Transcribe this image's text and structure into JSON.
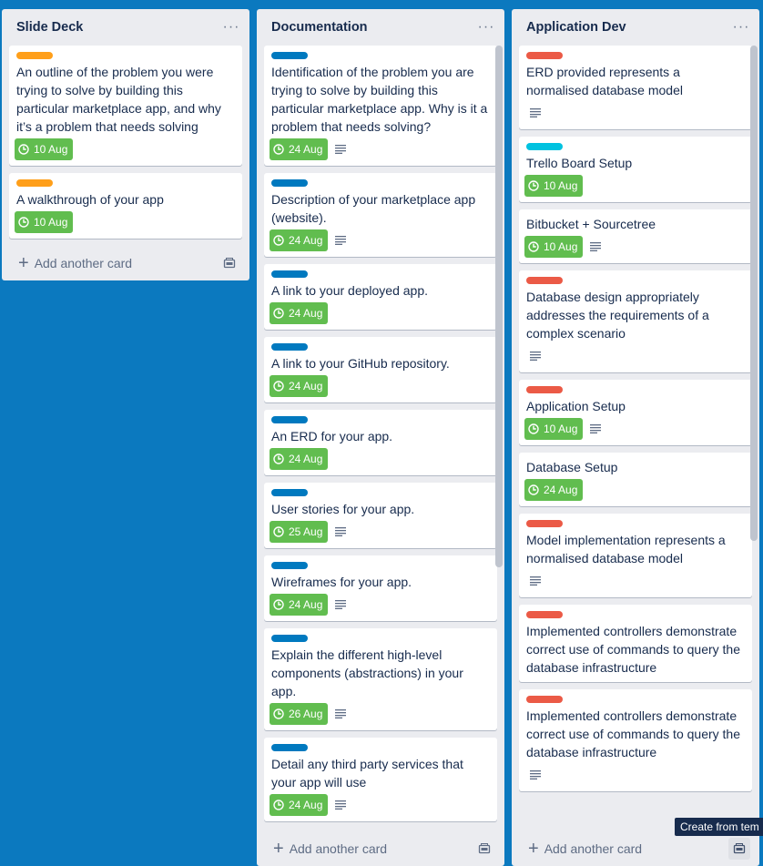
{
  "colors": {
    "board_bg": "#0b79bf",
    "label_orange": "#ff9f1a",
    "label_blue": "#0079bf",
    "label_red": "#eb5a46",
    "label_sky": "#00c2e0",
    "due_green": "#61bd4f"
  },
  "icons": {
    "menu": "ellipsis-icon",
    "due": "clock-icon",
    "description": "description-lines-icon",
    "add": "plus-icon",
    "template": "card-template-icon"
  },
  "add_card_label": "Add another card",
  "tooltip": "Create from tem",
  "lists": [
    {
      "title": "Slide Deck",
      "menu": "···",
      "cards": [
        {
          "label": "orange",
          "title": "An outline of the problem you were trying to solve by building this particular marketplace app, and why it’s a problem that needs solving",
          "due": "10 Aug",
          "desc": false
        },
        {
          "label": "orange",
          "title": "A walkthrough of your app",
          "due": "10 Aug",
          "desc": false
        }
      ]
    },
    {
      "title": "Documentation",
      "menu": "···",
      "cards": [
        {
          "label": "blue",
          "title": "Identification of the problem you are trying to solve by building this particular marketplace app. Why is it a problem that needs solving?",
          "due": "24 Aug",
          "desc": true
        },
        {
          "label": "blue",
          "title": "Description of your marketplace app (website).",
          "due": "24 Aug",
          "desc": true
        },
        {
          "label": "blue",
          "title": "A link to your deployed app.",
          "due": "24 Aug",
          "desc": false
        },
        {
          "label": "blue",
          "title": "A link to your GitHub repository.",
          "due": "24 Aug",
          "desc": false
        },
        {
          "label": "blue",
          "title": "An ERD for your app.",
          "due": "24 Aug",
          "desc": false
        },
        {
          "label": "blue",
          "title": "User stories for your app.",
          "due": "25 Aug",
          "desc": true
        },
        {
          "label": "blue",
          "title": "Wireframes for your app.",
          "due": "24 Aug",
          "desc": true
        },
        {
          "label": "blue",
          "title": "Explain the different high-level components (abstractions) in your app.",
          "due": "26 Aug",
          "desc": true
        },
        {
          "label": "blue",
          "title": "Detail any third party services that your app will use",
          "due": "24 Aug",
          "desc": true
        }
      ]
    },
    {
      "title": "Application Dev",
      "menu": "···",
      "cards": [
        {
          "label": "red",
          "title": "ERD provided represents a normalised database model",
          "due": "",
          "desc": true
        },
        {
          "label": "sky",
          "title": "Trello Board Setup",
          "due": "10 Aug",
          "desc": false
        },
        {
          "label": "",
          "title": "Bitbucket + Sourcetree",
          "due": "10 Aug",
          "desc": true
        },
        {
          "label": "red",
          "title": "Database design appropriately addresses the requirements of a complex scenario",
          "due": "",
          "desc": true
        },
        {
          "label": "red",
          "title": "Application Setup",
          "due": "10 Aug",
          "desc": true
        },
        {
          "label": "",
          "title": "Database Setup",
          "due": "24 Aug",
          "desc": false
        },
        {
          "label": "red",
          "title": "Model implementation represents a normalised database model",
          "due": "",
          "desc": true
        },
        {
          "label": "red",
          "title": "Implemented controllers demonstrate correct use of commands to query the database infrastructure",
          "due": "",
          "desc": false
        },
        {
          "label": "red",
          "title": "Implemented controllers demonstrate correct use of commands to query the database infrastructure",
          "due": "",
          "desc": true
        }
      ]
    }
  ]
}
